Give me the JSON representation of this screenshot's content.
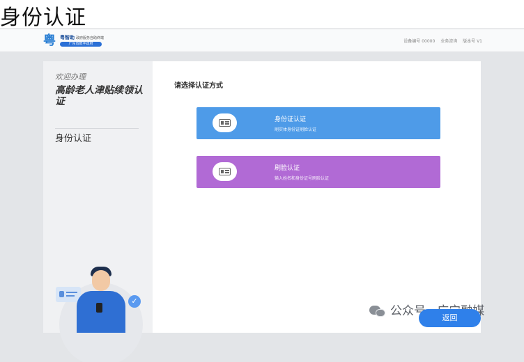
{
  "page_title": "身份认证",
  "header": {
    "logo_text": "粤智助",
    "logo_subtitle": "政府服务自助终端",
    "logo_tagline": "广东省数字政府",
    "nav": [
      "设备编号 00000",
      "业务咨询",
      "版本号 V1"
    ]
  },
  "sidebar": {
    "welcome": "欢迎办理",
    "title": "高龄老人津贴续领认证",
    "items": [
      {
        "label": "身份认证"
      }
    ]
  },
  "main": {
    "section_title": "请选择认证方式",
    "options": [
      {
        "label": "身份证认证",
        "desc": "刷实体身份证刷脸认证",
        "color": "#4e9be8"
      },
      {
        "label": "刷脸认证",
        "desc": "输入姓名和身份证号刷脸认证",
        "color": "#b16ad5"
      }
    ]
  },
  "footer": {
    "return_label": "返回",
    "watermark": "公众号 · 广宁融媒"
  }
}
